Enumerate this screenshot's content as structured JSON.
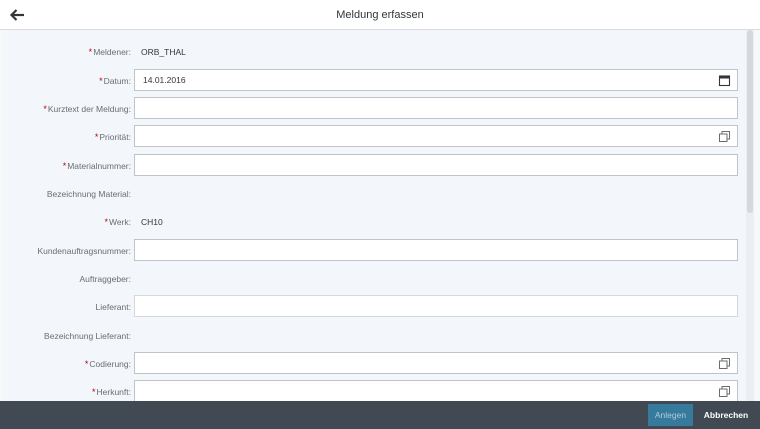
{
  "header": {
    "title": "Meldung erfassen",
    "back_icon": "arrow-left-icon"
  },
  "form": {
    "required_marker": "*",
    "meldener": {
      "label": "Meldener:",
      "value": "ORB_THAL"
    },
    "datum": {
      "label": "Datum:",
      "value": "14.01.2016",
      "icon": "calendar-icon"
    },
    "kurztext": {
      "label": "Kurztext der Meldung:",
      "value": ""
    },
    "prioritaet": {
      "label": "Priorität:",
      "value": "",
      "icon": "value-help-icon"
    },
    "materialnummer": {
      "label": "Materialnummer:",
      "value": ""
    },
    "bezeichnung_material": {
      "label": "Bezeichnung Material:",
      "value": ""
    },
    "werk": {
      "label": "Werk:",
      "value": "CH10"
    },
    "kundenauftragsnummer": {
      "label": "Kundenauftragsnummer:",
      "value": ""
    },
    "auftraggeber": {
      "label": "Auftraggeber:",
      "value": ""
    },
    "lieferant": {
      "label": "Lieferant:",
      "value": ""
    },
    "bezeichnung_lieferant": {
      "label": "Bezeichnung Lieferant:",
      "value": ""
    },
    "codierung": {
      "label": "Codierung:",
      "value": "",
      "icon": "value-help-icon"
    },
    "herkunft": {
      "label": "Herkunft:",
      "value": "",
      "icon": "value-help-icon"
    }
  },
  "footer": {
    "anlegen_label": "Anlegen",
    "abbrechen_label": "Abbrechen"
  },
  "colors": {
    "accent": "#367a9e",
    "footer_bg": "#414a53",
    "required": "#bb0000"
  }
}
